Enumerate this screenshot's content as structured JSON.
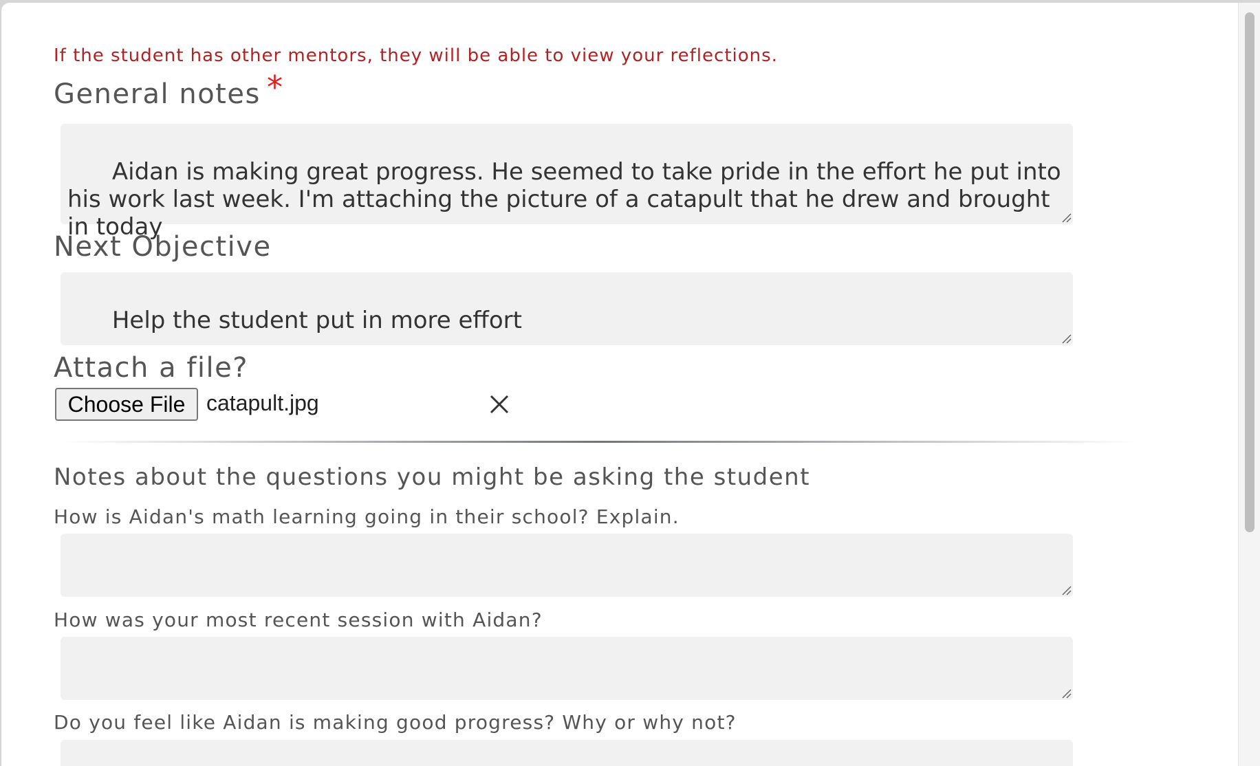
{
  "notice": "If the student has other mentors, they will be able to view your reflections.",
  "general_notes": {
    "label": "General notes",
    "required_marker": "*",
    "value": "Aidan is making great progress. He seemed to take pride in the effort he put into his work last week. I'm attaching the picture of a catapult that he drew and brought in today"
  },
  "next_objective": {
    "label": "Next Objective",
    "value": "Help the student put in more effort"
  },
  "attachment": {
    "label": "Attach a file?",
    "button_label": "Choose File",
    "file_name": "catapult.jpg",
    "clear_icon": "close-icon"
  },
  "questions_section": {
    "heading": "Notes about the questions you might be asking the student",
    "questions": [
      {
        "label": "How is Aidan's math learning going in their school? Explain.",
        "value": ""
      },
      {
        "label": "How was your most recent session with Aidan?",
        "value": ""
      },
      {
        "label": "Do you feel like Aidan is making good progress? Why or why not?",
        "value": ""
      }
    ]
  },
  "colors": {
    "notice": "#b22222",
    "required": "#e02020",
    "field_background": "#f1f1f1",
    "label_text": "#555555"
  }
}
